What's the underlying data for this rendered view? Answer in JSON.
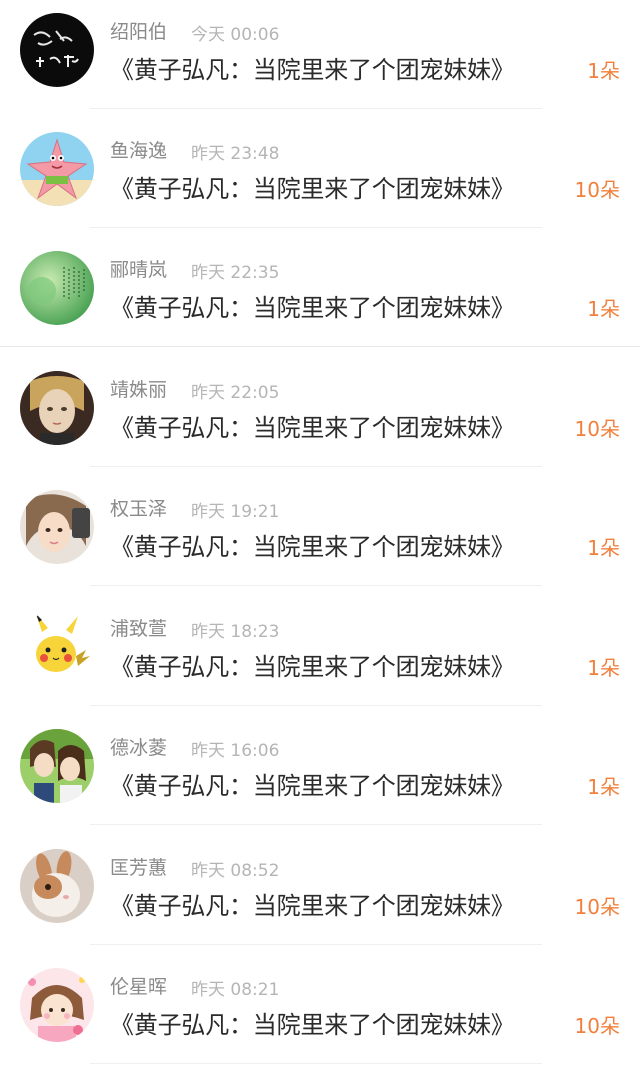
{
  "rows": [
    {
      "name": "绍阳伯",
      "time": "今天 00:06",
      "title": "《黄子弘凡：当院里来了个团宠妹妹》",
      "count": "1朵",
      "avatar_icon": "calligraphy-avatar-icon"
    },
    {
      "name": "鱼海逸",
      "time": "昨天 23:48",
      "title": "《黄子弘凡：当院里来了个团宠妹妹》",
      "count": "10朵",
      "avatar_icon": "starfish-avatar-icon"
    },
    {
      "name": "郦晴岚",
      "time": "昨天 22:35",
      "title": "《黄子弘凡：当院里来了个团宠妹妹》",
      "count": "1朵",
      "avatar_icon": "green-poem-avatar-icon"
    },
    {
      "name": "靖姝丽",
      "time": "昨天 22:05",
      "title": "《黄子弘凡：当院里来了个团宠妹妹》",
      "count": "10朵",
      "avatar_icon": "doll-avatar-icon"
    },
    {
      "name": "权玉泽",
      "time": "昨天 19:21",
      "title": "《黄子弘凡：当院里来了个团宠妹妹》",
      "count": "1朵",
      "avatar_icon": "girl-selfie-avatar-icon"
    },
    {
      "name": "浦致萱",
      "time": "昨天 18:23",
      "title": "《黄子弘凡：当院里来了个团宠妹妹》",
      "count": "1朵",
      "avatar_icon": "pikachu-avatar-icon"
    },
    {
      "name": "德冰菱",
      "time": "昨天 16:06",
      "title": "《黄子弘凡：当院里来了个团宠妹妹》",
      "count": "1朵",
      "avatar_icon": "anime-couple-avatar-icon"
    },
    {
      "name": "匡芳蕙",
      "time": "昨天 08:52",
      "title": "《黄子弘凡：当院里来了个团宠妹妹》",
      "count": "10朵",
      "avatar_icon": "rabbit-avatar-icon"
    },
    {
      "name": "伦星晖",
      "time": "昨天 08:21",
      "title": "《黄子弘凡：当院里来了个团宠妹妹》",
      "count": "10朵",
      "avatar_icon": "cartoon-girl-avatar-icon"
    }
  ],
  "colors": {
    "accent_count": "#f27f3b",
    "name_text": "#8a8a8a",
    "time_text": "#b5b5b5",
    "title_text": "#2b2b2b"
  }
}
